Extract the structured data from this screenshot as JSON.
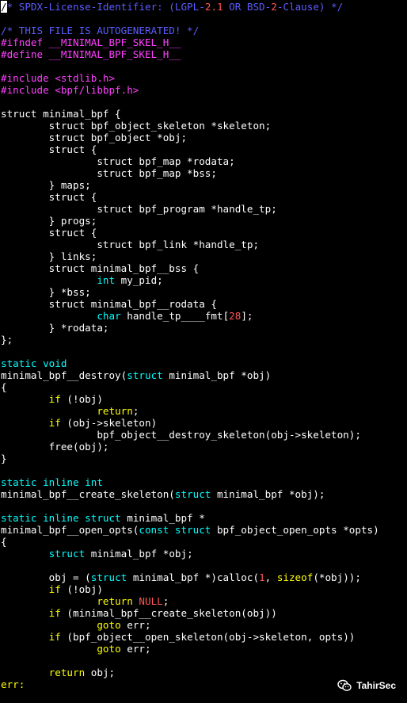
{
  "colors": {
    "background": "#000000",
    "default": "#ffffff",
    "comment": "#5c5cff",
    "preproc": "#ff40ff",
    "type": "#00ffff",
    "keyword": "#ffff00",
    "number": "#ff5555",
    "constant": "#ff5555"
  },
  "watermark": {
    "icon": "wechat-icon",
    "text": "TahirSec"
  },
  "lines": [
    [
      {
        "t": "/",
        "c": "cursor"
      },
      {
        "t": "* SPDX-License-Identifier: (LGPL-",
        "c": "comment"
      },
      {
        "t": "2.1",
        "c": "number"
      },
      {
        "t": " OR BSD-",
        "c": "comment"
      },
      {
        "t": "2",
        "c": "number"
      },
      {
        "t": "-Clause) */",
        "c": "comment"
      }
    ],
    [],
    [
      {
        "t": "/* THIS FILE IS AUTOGENERATED! */",
        "c": "comment"
      }
    ],
    [
      {
        "t": "#ifndef __MINIMAL_BPF_SKEL_H__",
        "c": "preproc"
      }
    ],
    [
      {
        "t": "#define __MINIMAL_BPF_SKEL_H__",
        "c": "preproc"
      }
    ],
    [],
    [
      {
        "t": "#include <stdlib.h>",
        "c": "preproc"
      }
    ],
    [
      {
        "t": "#include <bpf/libbpf.h>",
        "c": "preproc"
      }
    ],
    [],
    [
      {
        "t": "struct minimal_bpf {",
        "c": "default"
      }
    ],
    [
      {
        "t": "        struct bpf_object_skeleton *skeleton;",
        "c": "default"
      }
    ],
    [
      {
        "t": "        struct bpf_object *obj;",
        "c": "default"
      }
    ],
    [
      {
        "t": "        struct {",
        "c": "default"
      }
    ],
    [
      {
        "t": "                struct bpf_map *rodata;",
        "c": "default"
      }
    ],
    [
      {
        "t": "                struct bpf_map *bss;",
        "c": "default"
      }
    ],
    [
      {
        "t": "        } maps;",
        "c": "default"
      }
    ],
    [
      {
        "t": "        struct {",
        "c": "default"
      }
    ],
    [
      {
        "t": "                struct bpf_program *handle_tp;",
        "c": "default"
      }
    ],
    [
      {
        "t": "        } progs;",
        "c": "default"
      }
    ],
    [
      {
        "t": "        struct {",
        "c": "default"
      }
    ],
    [
      {
        "t": "                struct bpf_link *handle_tp;",
        "c": "default"
      }
    ],
    [
      {
        "t": "        } links;",
        "c": "default"
      }
    ],
    [
      {
        "t": "        struct minimal_bpf__bss {",
        "c": "default"
      }
    ],
    [
      {
        "t": "                ",
        "c": "default"
      },
      {
        "t": "int",
        "c": "type"
      },
      {
        "t": " my_pid;",
        "c": "default"
      }
    ],
    [
      {
        "t": "        } *bss;",
        "c": "default"
      }
    ],
    [
      {
        "t": "        struct minimal_bpf__rodata {",
        "c": "default"
      }
    ],
    [
      {
        "t": "                ",
        "c": "default"
      },
      {
        "t": "char",
        "c": "type"
      },
      {
        "t": " handle_tp____fmt[",
        "c": "default"
      },
      {
        "t": "28",
        "c": "number"
      },
      {
        "t": "];",
        "c": "default"
      }
    ],
    [
      {
        "t": "        } *rodata;",
        "c": "default"
      }
    ],
    [
      {
        "t": "};",
        "c": "default"
      }
    ],
    [],
    [
      {
        "t": "static void",
        "c": "type"
      }
    ],
    [
      {
        "t": "minimal_bpf__destroy(",
        "c": "default"
      },
      {
        "t": "struct",
        "c": "type"
      },
      {
        "t": " minimal_bpf *obj)",
        "c": "default"
      }
    ],
    [
      {
        "t": "{",
        "c": "default"
      }
    ],
    [
      {
        "t": "        ",
        "c": "default"
      },
      {
        "t": "if",
        "c": "keyword"
      },
      {
        "t": " (!obj)",
        "c": "default"
      }
    ],
    [
      {
        "t": "                ",
        "c": "default"
      },
      {
        "t": "return",
        "c": "keyword"
      },
      {
        "t": ";",
        "c": "default"
      }
    ],
    [
      {
        "t": "        ",
        "c": "default"
      },
      {
        "t": "if",
        "c": "keyword"
      },
      {
        "t": " (obj->skeleton)",
        "c": "default"
      }
    ],
    [
      {
        "t": "                bpf_object__destroy_skeleton(obj->skeleton);",
        "c": "default"
      }
    ],
    [
      {
        "t": "        free(obj);",
        "c": "default"
      }
    ],
    [
      {
        "t": "}",
        "c": "default"
      }
    ],
    [],
    [
      {
        "t": "static inline int",
        "c": "type"
      }
    ],
    [
      {
        "t": "minimal_bpf__create_skeleton(",
        "c": "default"
      },
      {
        "t": "struct",
        "c": "type"
      },
      {
        "t": " minimal_bpf *obj);",
        "c": "default"
      }
    ],
    [],
    [
      {
        "t": "static inline struct",
        "c": "type"
      },
      {
        "t": " minimal_bpf *",
        "c": "default"
      }
    ],
    [
      {
        "t": "minimal_bpf__open_opts(",
        "c": "default"
      },
      {
        "t": "const struct",
        "c": "type"
      },
      {
        "t": " bpf_object_open_opts *opts)",
        "c": "default"
      }
    ],
    [
      {
        "t": "{",
        "c": "default"
      }
    ],
    [
      {
        "t": "        ",
        "c": "default"
      },
      {
        "t": "struct",
        "c": "type"
      },
      {
        "t": " minimal_bpf *obj;",
        "c": "default"
      }
    ],
    [],
    [
      {
        "t": "        obj = (",
        "c": "default"
      },
      {
        "t": "struct",
        "c": "type"
      },
      {
        "t": " minimal_bpf *)calloc(",
        "c": "default"
      },
      {
        "t": "1",
        "c": "number"
      },
      {
        "t": ", ",
        "c": "default"
      },
      {
        "t": "sizeof",
        "c": "keyword"
      },
      {
        "t": "(*obj));",
        "c": "default"
      }
    ],
    [
      {
        "t": "        ",
        "c": "default"
      },
      {
        "t": "if",
        "c": "keyword"
      },
      {
        "t": " (!obj)",
        "c": "default"
      }
    ],
    [
      {
        "t": "                ",
        "c": "default"
      },
      {
        "t": "return",
        "c": "keyword"
      },
      {
        "t": " ",
        "c": "default"
      },
      {
        "t": "NULL",
        "c": "constant"
      },
      {
        "t": ";",
        "c": "default"
      }
    ],
    [
      {
        "t": "        ",
        "c": "default"
      },
      {
        "t": "if",
        "c": "keyword"
      },
      {
        "t": " (minimal_bpf__create_skeleton(obj))",
        "c": "default"
      }
    ],
    [
      {
        "t": "                ",
        "c": "default"
      },
      {
        "t": "goto",
        "c": "keyword"
      },
      {
        "t": " err;",
        "c": "default"
      }
    ],
    [
      {
        "t": "        ",
        "c": "default"
      },
      {
        "t": "if",
        "c": "keyword"
      },
      {
        "t": " (bpf_object__open_skeleton(obj->skeleton, opts))",
        "c": "default"
      }
    ],
    [
      {
        "t": "                ",
        "c": "default"
      },
      {
        "t": "goto",
        "c": "keyword"
      },
      {
        "t": " err;",
        "c": "default"
      }
    ],
    [],
    [
      {
        "t": "        ",
        "c": "default"
      },
      {
        "t": "return",
        "c": "keyword"
      },
      {
        "t": " obj;",
        "c": "default"
      }
    ],
    [
      {
        "t": "err:",
        "c": "keyword"
      }
    ]
  ]
}
